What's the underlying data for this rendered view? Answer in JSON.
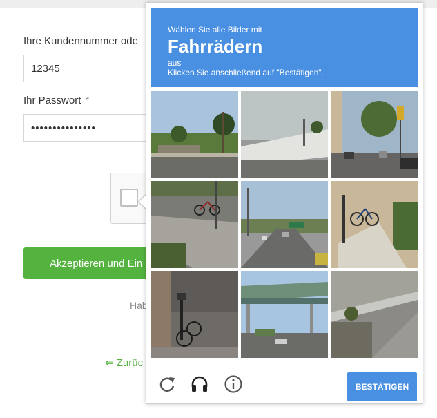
{
  "login_form": {
    "customer_label": "Ihre Kundennummer ode",
    "customer_value": "12345",
    "password_label": "Ihr Passwort",
    "required_marker": "*",
    "password_value": "•••••••••••••••",
    "accept_button": "Akzeptieren und Ein",
    "hint_text": "Hab",
    "back_link": "⇐ Zurüc"
  },
  "challenge": {
    "line1": "Wählen Sie alle Bilder mit",
    "target": "Fahrrädern",
    "line3": "aus",
    "line4": "Klicken Sie anschließend auf \"Bestätigen\".",
    "tiles": [
      "tile-street-palm-houses",
      "tile-road-white-wall",
      "tile-city-street-traffic-light",
      "tile-sidewalk-with-bicycle",
      "tile-wide-road-traffic",
      "tile-house-stairs-bicycle",
      "tile-sidewalk-parked-bicycle",
      "tile-overpass-bridge",
      "tile-hillside-guardrail"
    ],
    "verify_button": "BESTÄTIGEN",
    "footer_icons": [
      "reload-icon",
      "audio-icon",
      "info-icon"
    ]
  },
  "colors": {
    "accent_blue": "#4a90e2",
    "accept_green": "#54b33f"
  }
}
